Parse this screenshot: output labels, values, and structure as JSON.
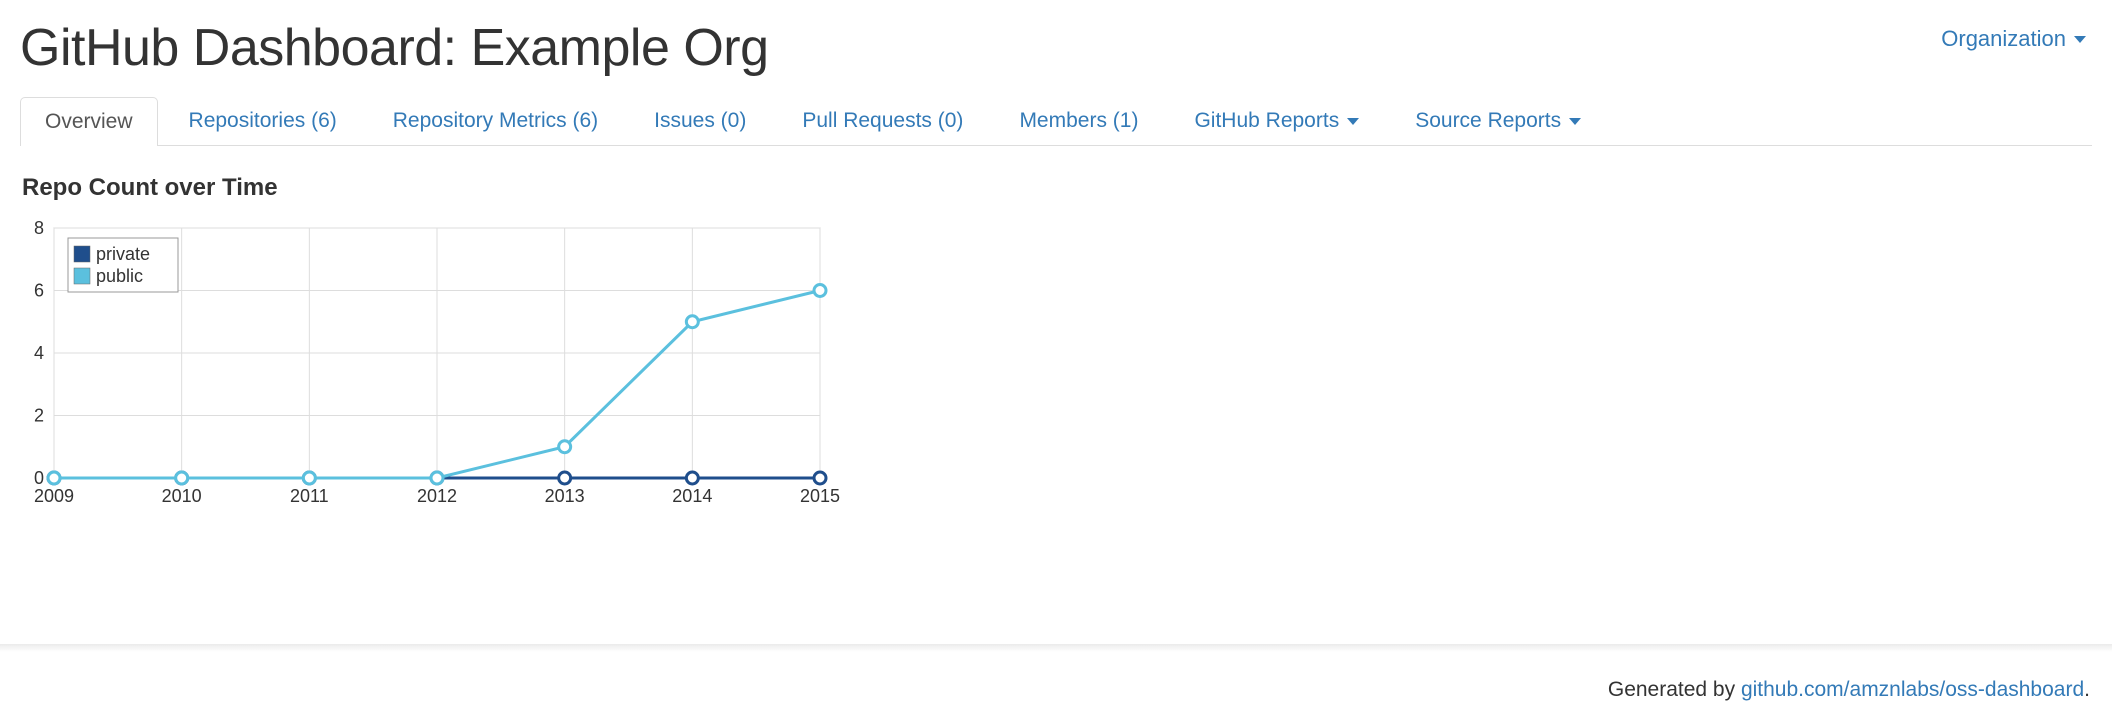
{
  "header": {
    "title": "GitHub Dashboard: Example Org",
    "org_dropdown_label": "Organization"
  },
  "tabs": [
    {
      "label": "Overview",
      "active": true,
      "dropdown": false
    },
    {
      "label": "Repositories (6)",
      "active": false,
      "dropdown": false
    },
    {
      "label": "Repository Metrics (6)",
      "active": false,
      "dropdown": false
    },
    {
      "label": "Issues (0)",
      "active": false,
      "dropdown": false
    },
    {
      "label": "Pull Requests (0)",
      "active": false,
      "dropdown": false
    },
    {
      "label": "Members (1)",
      "active": false,
      "dropdown": false
    },
    {
      "label": "GitHub Reports",
      "active": false,
      "dropdown": true
    },
    {
      "label": "Source Reports",
      "active": false,
      "dropdown": true
    }
  ],
  "chart_section_title": "Repo Count over Time",
  "chart_data": {
    "type": "line",
    "x": [
      2009,
      2010,
      2011,
      2012,
      2013,
      2014,
      2015
    ],
    "series": [
      {
        "name": "private",
        "color": "#1f4e8c",
        "values": [
          0,
          0,
          0,
          0,
          0,
          0,
          0
        ]
      },
      {
        "name": "public",
        "color": "#5bc0de",
        "values": [
          0,
          0,
          0,
          0,
          1,
          5,
          6
        ]
      }
    ],
    "title": "",
    "xlabel": "",
    "ylabel": "",
    "ylim": [
      0,
      8
    ],
    "yticks": [
      0,
      2,
      4,
      6,
      8
    ],
    "grid": true,
    "legend_position": "top-left"
  },
  "colors": {
    "link": "#337ab7",
    "series_private": "#1f4e8c",
    "series_public": "#5bc0de"
  },
  "footer": {
    "prefix": "Generated by ",
    "link_text": "github.com/amznlabs/oss-dashboard",
    "suffix": "."
  }
}
